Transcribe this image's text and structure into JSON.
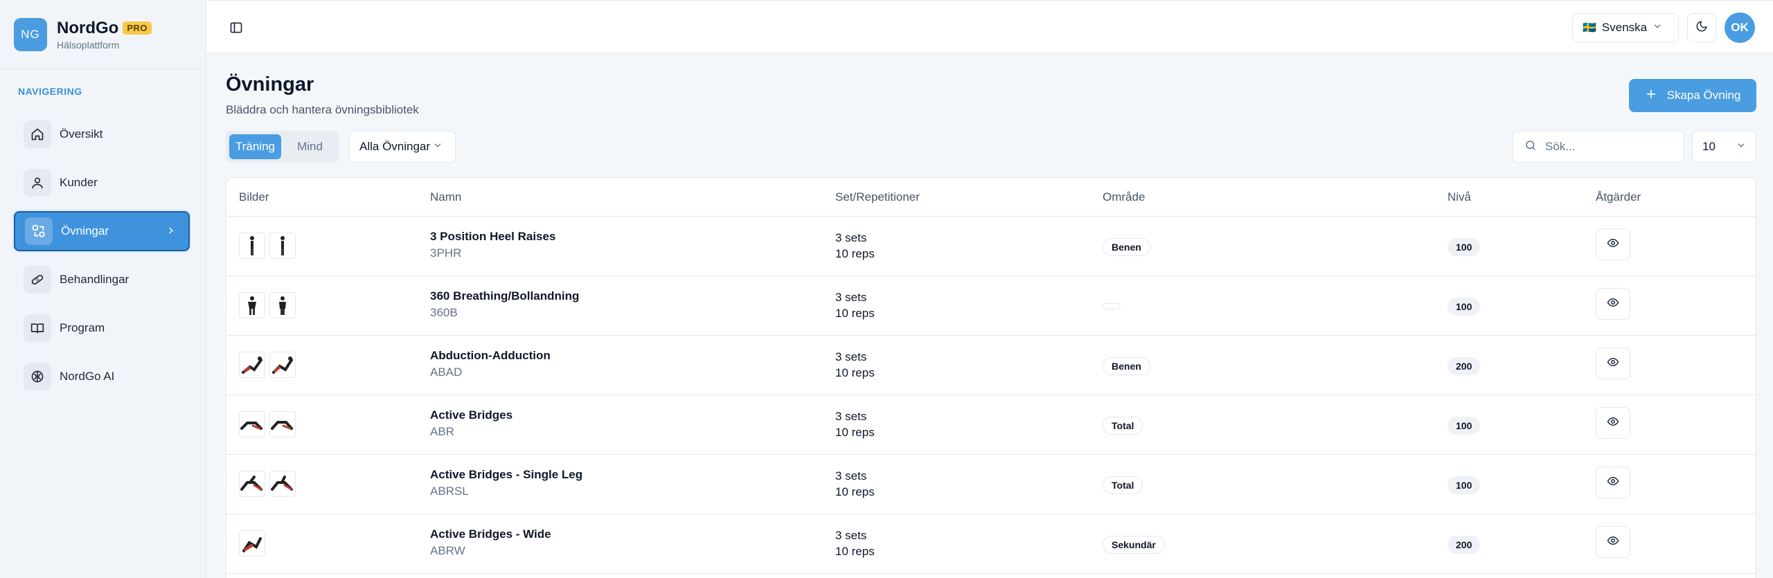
{
  "brand": {
    "logo": "NG",
    "name": "NordGo",
    "badge": "PRO",
    "subtitle": "Hälsoplattform"
  },
  "sidebar": {
    "heading": "NAVIGERING",
    "items": [
      {
        "label": "Översikt",
        "icon": "home-icon"
      },
      {
        "label": "Kunder",
        "icon": "user-icon"
      },
      {
        "label": "Övningar",
        "icon": "exercise-icon",
        "active": true
      },
      {
        "label": "Behandlingar",
        "icon": "bandage-icon"
      },
      {
        "label": "Program",
        "icon": "book-icon"
      },
      {
        "label": "NordGo AI",
        "icon": "brain-icon"
      }
    ]
  },
  "header": {
    "language": "Svenska",
    "flag": "🇸🇪",
    "avatar": "OK"
  },
  "page": {
    "title": "Övningar",
    "subtitle": "Bläddra och hantera övningsbibliotek",
    "create_label": "Skapa Övning"
  },
  "filters": {
    "tabs": [
      "Träning",
      "Mind"
    ],
    "category": "Alla Övningar",
    "search_placeholder": "Sök...",
    "page_size": "10"
  },
  "table": {
    "headers": [
      "Bilder",
      "Namn",
      "Set/Repetitioner",
      "Område",
      "Nivå",
      "Åtgärder"
    ],
    "rows": [
      {
        "name": "3 Position Heel Raises",
        "code": "3PHR",
        "sets": "3 sets",
        "reps": "10 reps",
        "area": "Benen",
        "level": "100",
        "thumbs": 2
      },
      {
        "name": "360 Breathing/Bollandning",
        "code": "360B",
        "sets": "3 sets",
        "reps": "10 reps",
        "area": "",
        "level": "100",
        "thumbs": 2
      },
      {
        "name": "Abduction-Adduction",
        "code": "ABAD",
        "sets": "3 sets",
        "reps": "10 reps",
        "area": "Benen",
        "level": "200",
        "thumbs": 2
      },
      {
        "name": "Active Bridges",
        "code": "ABR",
        "sets": "3 sets",
        "reps": "10 reps",
        "area": "Total",
        "level": "100",
        "thumbs": 2
      },
      {
        "name": "Active Bridges - Single Leg",
        "code": "ABRSL",
        "sets": "3 sets",
        "reps": "10 reps",
        "area": "Total",
        "level": "100",
        "thumbs": 2
      },
      {
        "name": "Active Bridges - Wide",
        "code": "ABRW",
        "sets": "3 sets",
        "reps": "10 reps",
        "area": "Sekundär",
        "level": "200",
        "thumbs": 1
      }
    ]
  },
  "colors": {
    "accent": "#4a9de0",
    "badge": "#f7c948"
  }
}
